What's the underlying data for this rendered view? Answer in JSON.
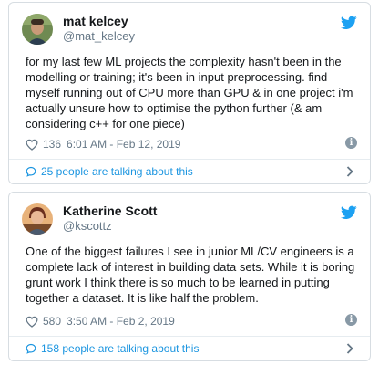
{
  "tweets": [
    {
      "display_name": "mat kelcey",
      "handle": "@mat_kelcey",
      "text": "for my last few ML projects the complexity hasn't been in the modelling or training; it's been in input preprocessing. find myself running out of CPU more than GPU & in one project i'm actually unsure how to optimise the python further (& am considering c++ for one piece)",
      "likes": "136",
      "timestamp": "6:01 AM - Feb 12, 2019",
      "talking": "25 people are talking about this",
      "icons": [
        "avatar",
        "twitter-bird-icon",
        "heart-icon",
        "info-icon",
        "comment-bubble-icon",
        "chevron-right-icon"
      ]
    },
    {
      "display_name": "Katherine Scott",
      "handle": "@kscottz",
      "text": "One of the biggest failures I see in junior ML/CV engineers is a complete lack of interest in building data sets. While it is boring grunt work I think there is so much to be learned in putting together a dataset. It is like half the problem.",
      "likes": "580",
      "timestamp": "3:50 AM - Feb 2, 2019",
      "talking": "158 people are talking about this",
      "icons": [
        "avatar",
        "twitter-bird-icon",
        "heart-icon",
        "info-icon",
        "comment-bubble-icon",
        "chevron-right-icon"
      ]
    }
  ],
  "colors": {
    "twitter_blue": "#1da1f2",
    "link_blue": "#1b95e0",
    "text": "#14171a",
    "muted": "#657786",
    "border": "#d7dde2"
  }
}
